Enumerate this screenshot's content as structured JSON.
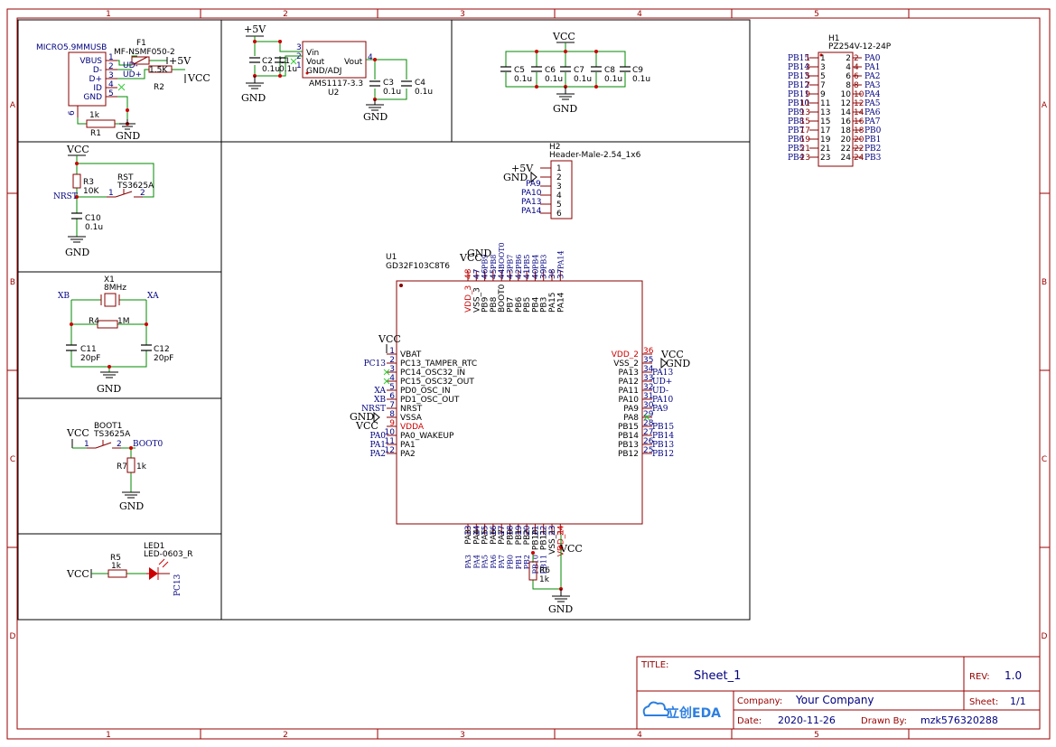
{
  "colors": {
    "frame": "#990000",
    "wire": "#008800",
    "body": "#880000",
    "pin": "#880000",
    "label": "#000080",
    "net": "#000080",
    "junction": "#cc0000",
    "text": "#000000",
    "power_pin": "#cc0000",
    "noconnect": "#33cc33"
  },
  "frame": {
    "col_labels": [
      "1",
      "2",
      "3",
      "4",
      "5"
    ],
    "row_labels": [
      "A",
      "B",
      "C",
      "D"
    ]
  },
  "title_block": {
    "title_label": "TITLE:",
    "title": "Sheet_1",
    "rev_label": "REV:",
    "rev": "1.0",
    "company_label": "Company:",
    "company": "Your Company",
    "sheet_label": "Sheet:",
    "sheet": "1/1",
    "date_label": "Date:",
    "date": "2020-11-26",
    "drawn_label": "Drawn By:",
    "drawn": "mzk576320288",
    "logo": "立创EDA"
  },
  "usb": {
    "name": "MICRO5.9MMUSB",
    "pins": [
      [
        "VBUS",
        "1"
      ],
      [
        "D-",
        "2"
      ],
      [
        "D+",
        "3"
      ],
      [
        "ID",
        "4"
      ],
      [
        "GND",
        "5"
      ]
    ],
    "shield_pin": "6",
    "f1_ref": "F1",
    "f1_val": "MF-NSMF050-2",
    "r1_ref": "R1",
    "r1_val": "1k",
    "r2_ref": "R2",
    "r2_val": "1.5K",
    "net_plus5v": "+5V",
    "net_vcc": "VCC",
    "net_gnd": "GND",
    "net_udm": "UD-",
    "net_udp": "UD+"
  },
  "ldo": {
    "name": "AMS1117-3.3",
    "ref": "U2",
    "pin_vin": "Vin",
    "pin_vout_l": "Vout",
    "pin_gnd": "GND/ADJ",
    "pin_vout_r": "Vout",
    "pin_nums": [
      "3",
      "2",
      "1",
      "4"
    ],
    "c2_ref": "C2",
    "c2_val": "0.1u",
    "c1_ref": "C1",
    "c1_val": "0.1u",
    "c3_ref": "C3",
    "c3_val": "0.1u",
    "c4_ref": "C4",
    "c4_val": "0.1u",
    "net_plus5v": "+5V",
    "net_gnd1": "GND",
    "net_gnd2": "GND"
  },
  "decoup": {
    "net_vcc": "VCC",
    "net_gnd": "GND",
    "caps": [
      [
        "C5",
        "0.1u"
      ],
      [
        "C6",
        "0.1u"
      ],
      [
        "C7",
        "0.1u"
      ],
      [
        "C8",
        "0.1u"
      ],
      [
        "C9",
        "0.1u"
      ]
    ]
  },
  "reset": {
    "net_vcc": "VCC",
    "r_ref": "R3",
    "r_val": "10K",
    "net_nrst": "NRST",
    "sw_ref": "RST",
    "sw_val": "TS3625A",
    "sw_pins": [
      "1",
      "2"
    ],
    "c_ref": "C10",
    "c_val": "0.1u",
    "net_gnd": "GND"
  },
  "xtal": {
    "ref": "X1",
    "val": "8MHz",
    "net_xb": "XB",
    "net_xa": "XA",
    "r_ref": "R4",
    "r_val": "1M",
    "c11_ref": "C11",
    "c11_val": "20pF",
    "c12_ref": "C12",
    "c12_val": "20pF",
    "net_gnd": "GND"
  },
  "boot": {
    "ref": "BOOT1",
    "val": "TS3625A",
    "net_vcc": "VCC",
    "pins": [
      "1",
      "2"
    ],
    "net_boot0": "BOOT0",
    "r_ref": "R7",
    "r_val": "1k",
    "net_gnd": "GND"
  },
  "led": {
    "net_vcc": "VCC",
    "r_ref": "R5",
    "r_val": "1k",
    "ref": "LED1",
    "val": "LED-0603_R",
    "net_pc13": "PC13"
  },
  "header2": {
    "ref": "H2",
    "val": "Header-Male-2.54_1x6",
    "pins": [
      "1",
      "2",
      "3",
      "4",
      "5",
      "6"
    ],
    "nets": [
      "+5V",
      "GND",
      "PA9",
      "PA10",
      "PA13",
      "PA14"
    ]
  },
  "header1": {
    "ref": "H1",
    "val": "PZ254V-12-24P",
    "left": [
      [
        "PB15",
        "1"
      ],
      [
        "PB14",
        "3"
      ],
      [
        "PB13",
        "5"
      ],
      [
        "PB12",
        "7"
      ],
      [
        "PB11",
        "9"
      ],
      [
        "PB10",
        "11"
      ],
      [
        "PB9",
        "13"
      ],
      [
        "PB8",
        "15"
      ],
      [
        "PB7",
        "17"
      ],
      [
        "PB6",
        "19"
      ],
      [
        "PB5",
        "21"
      ],
      [
        "PB4",
        "23"
      ]
    ],
    "right": [
      [
        "PA0",
        "2"
      ],
      [
        "PA1",
        "4"
      ],
      [
        "PA2",
        "6"
      ],
      [
        "PA3",
        "8"
      ],
      [
        "PA4",
        "10"
      ],
      [
        "PA5",
        "12"
      ],
      [
        "PA6",
        "14"
      ],
      [
        "PA7",
        "16"
      ],
      [
        "PB0",
        "18"
      ],
      [
        "PB1",
        "20"
      ],
      [
        "PB2",
        "22"
      ],
      [
        "PB3",
        "24"
      ]
    ]
  },
  "mcu": {
    "ref": "U1",
    "name": "GD32F103C8T6",
    "left": [
      [
        "VBAT",
        "1"
      ],
      [
        "PC13_TAMPER_RTC",
        "2"
      ],
      [
        "PC14_OSC32_IN",
        "3"
      ],
      [
        "PC15_OSC32_OUT",
        "4"
      ],
      [
        "PD0_OSC_IN",
        "5"
      ],
      [
        "PD1_OSC_OUT",
        "6"
      ],
      [
        "NRST",
        "7"
      ],
      [
        "VSSA",
        "8"
      ],
      [
        "VDDA",
        "9"
      ],
      [
        "PA0_WAKEUP",
        "10"
      ],
      [
        "PA1",
        "11"
      ],
      [
        "PA2",
        "12"
      ]
    ],
    "left_nets": [
      "VCC",
      "PC13",
      "",
      "",
      "XA",
      "XB",
      "NRST",
      "GND",
      "VCC",
      "PA0",
      "PA1",
      "PA2"
    ],
    "right": [
      [
        "VDD_2",
        "36"
      ],
      [
        "VSS_2",
        "35"
      ],
      [
        "PA13",
        "34"
      ],
      [
        "PA12",
        "33"
      ],
      [
        "PA11",
        "32"
      ],
      [
        "PA10",
        "31"
      ],
      [
        "PA9",
        "30"
      ],
      [
        "PA8",
        "29"
      ],
      [
        "PB15",
        "28"
      ],
      [
        "PB14",
        "27"
      ],
      [
        "PB13",
        "26"
      ],
      [
        "PB12",
        "25"
      ]
    ],
    "right_nets": [
      "VCC",
      "GND",
      "PA13",
      "UD+",
      "UD-",
      "PA10",
      "PA9",
      "",
      "PB15",
      "PB14",
      "PB13",
      "PB12"
    ],
    "top": [
      [
        "VDD_3",
        "48"
      ],
      [
        "VSS_3",
        "47"
      ],
      [
        "PB9",
        "46"
      ],
      [
        "PB8",
        "45"
      ],
      [
        "BOOT0",
        "44"
      ],
      [
        "PB7",
        "43"
      ],
      [
        "PB6",
        "42"
      ],
      [
        "PB5",
        "41"
      ],
      [
        "PB4",
        "40"
      ],
      [
        "PB3",
        "39"
      ],
      [
        "PA15",
        "38"
      ],
      [
        "PA14",
        "37"
      ]
    ],
    "top_nets": [
      "VCC",
      "GND",
      "PB9",
      "PB8",
      "BOOT0",
      "PB7",
      "PB6",
      "PB5",
      "PB4",
      "PB3",
      "",
      "PA14"
    ],
    "bottom": [
      [
        "PA3",
        "13"
      ],
      [
        "PA4",
        "14"
      ],
      [
        "PA5",
        "15"
      ],
      [
        "PA6",
        "16"
      ],
      [
        "PA7",
        "17"
      ],
      [
        "PB0",
        "18"
      ],
      [
        "PB1",
        "19"
      ],
      [
        "PB2",
        "20"
      ],
      [
        "PB10",
        "21"
      ],
      [
        "PB11",
        "22"
      ],
      [
        "VSS_1",
        "23"
      ],
      [
        "VDD_1",
        "24"
      ]
    ],
    "bottom_nets": [
      "PA3",
      "PA4",
      "PA5",
      "PA6",
      "PA7",
      "PB0",
      "PB1",
      "PB2",
      "PB10",
      "PB11",
      "",
      ""
    ],
    "r6_ref": "R6",
    "r6_val": "1k",
    "net_vcc": "VCC",
    "net_gnd": "GND"
  }
}
